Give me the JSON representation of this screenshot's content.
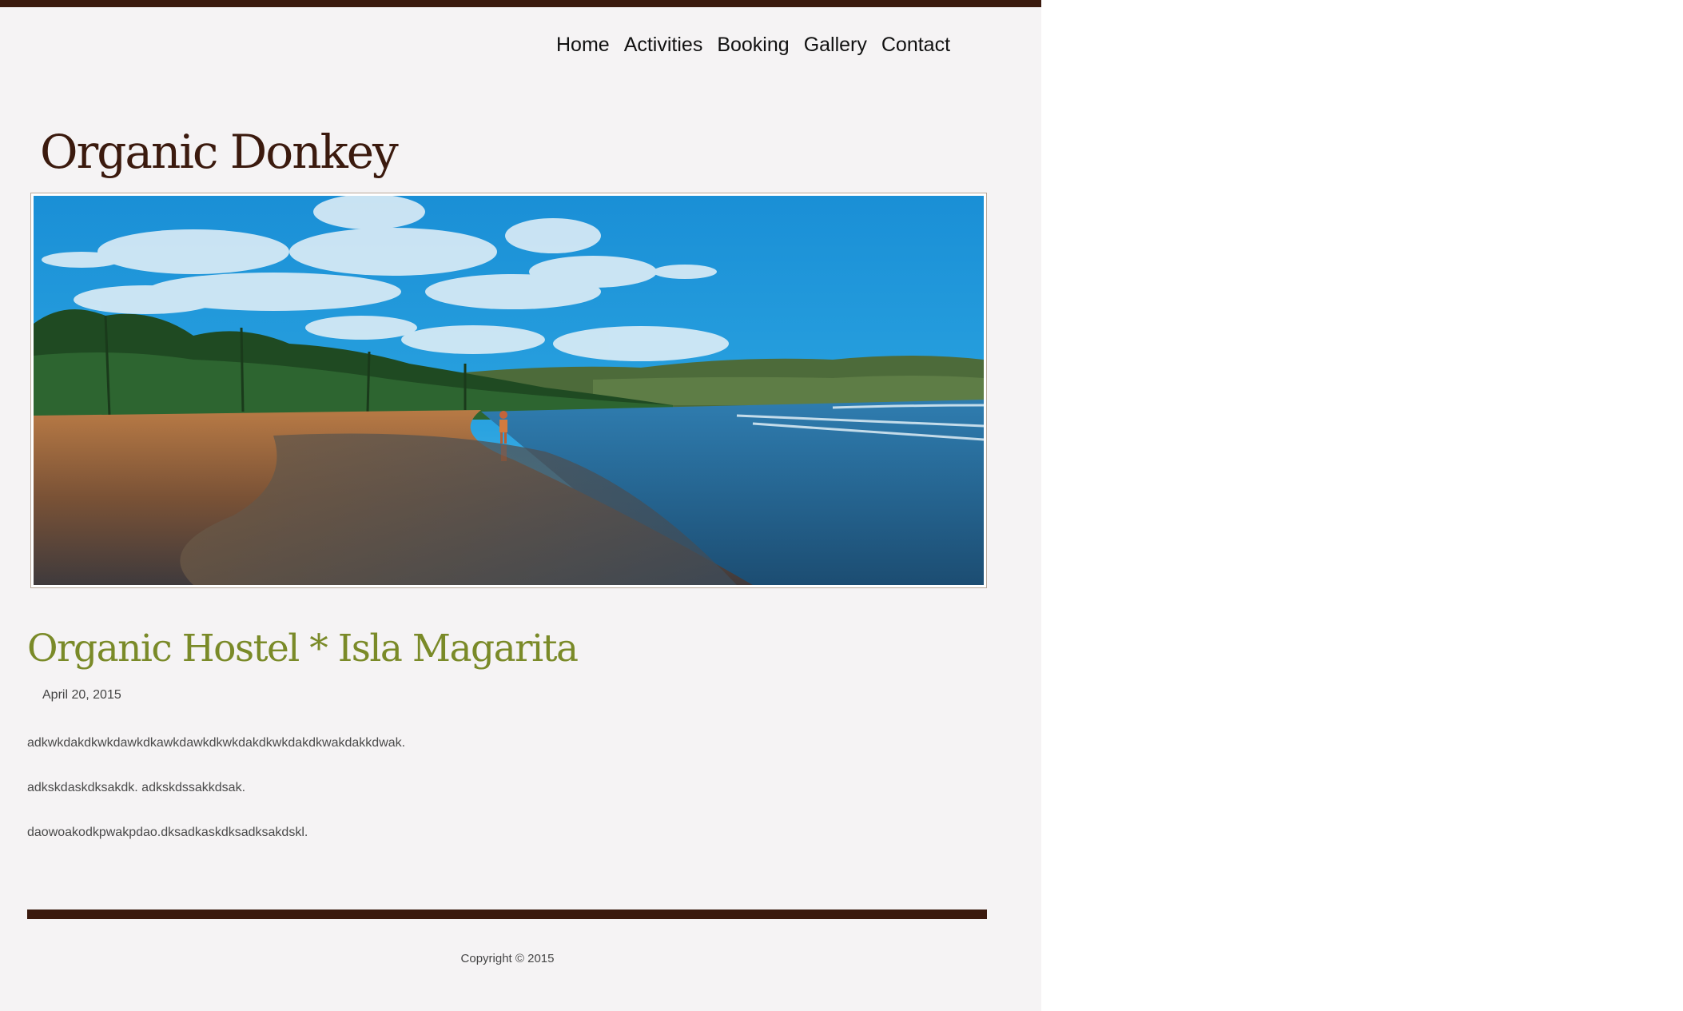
{
  "nav": {
    "items": [
      {
        "label": "Home"
      },
      {
        "label": "Activities"
      },
      {
        "label": "Booking"
      },
      {
        "label": "Gallery"
      },
      {
        "label": "Contact"
      }
    ]
  },
  "site": {
    "title": "Organic Donkey"
  },
  "post": {
    "title": "Organic Hostel * Isla Magarita",
    "date": "April 20, 2015",
    "paragraphs": [
      "adkwkdakdkwkdawkdkawkdawkdkwkdakdkwkdakdkwakdakkdwak.",
      "adkskdaskdksakdk. adkskdssakkdsak.",
      "daowoakodkpwakpdao.dksadkaskdksadksakdskl."
    ]
  },
  "footer": {
    "copyright": "Copyright © 2015"
  },
  "colors": {
    "brand_dark": "#3b1a0e",
    "title_green": "#7a8a28",
    "page_bg": "#f5f3f4"
  }
}
